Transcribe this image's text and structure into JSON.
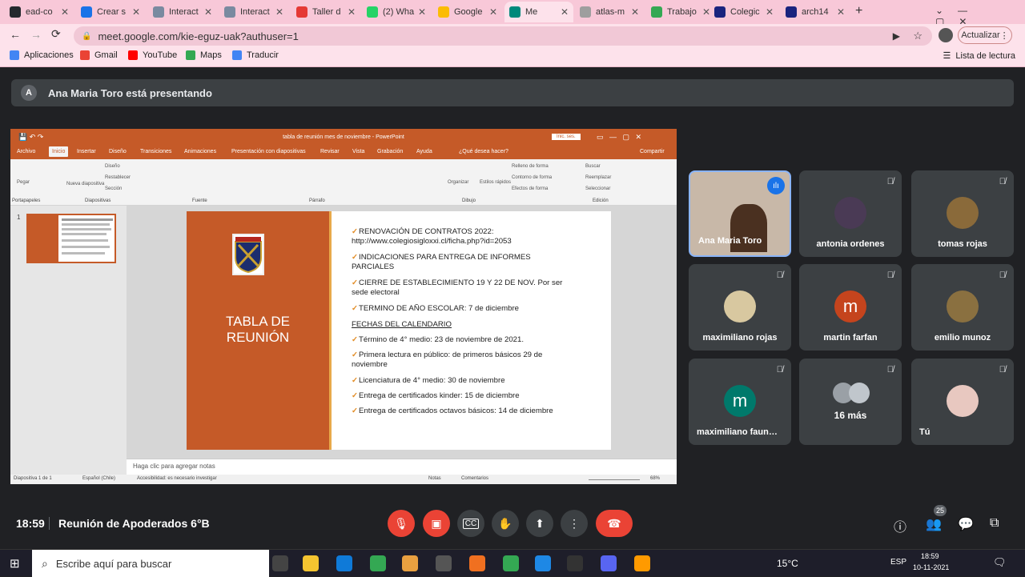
{
  "browser": {
    "tabs": [
      {
        "label": "ead-co",
        "color": "#24292e"
      },
      {
        "label": "Crear s",
        "color": "#1a73e8"
      },
      {
        "label": "Interact",
        "color": "#7a8aa0"
      },
      {
        "label": "Interact",
        "color": "#7a8aa0"
      },
      {
        "label": "Taller d",
        "color": "#e53935"
      },
      {
        "label": "(2) Wha",
        "color": "#25d366"
      },
      {
        "label": "Google",
        "color": "#fbbc04"
      },
      {
        "label": "Me",
        "color": "#00897b",
        "active": true
      },
      {
        "label": "atlas-m",
        "color": "#9e9e9e"
      },
      {
        "label": "Trabajo",
        "color": "#34a853"
      },
      {
        "label": "Colegic",
        "color": "#1a237e"
      },
      {
        "label": "arch14",
        "color": "#1a237e"
      }
    ],
    "url": "meet.google.com/kie-eguz-uak?authuser=1",
    "update_label": "Actualizar",
    "bookmarks": [
      {
        "label": "Aplicaciones",
        "color": "#4285f4"
      },
      {
        "label": "Gmail",
        "color": "#ea4335"
      },
      {
        "label": "YouTube",
        "color": "#ff0000"
      },
      {
        "label": "Maps",
        "color": "#34a853"
      },
      {
        "label": "Traducir",
        "color": "#4285f4"
      }
    ],
    "reading_list": "Lista de lectura"
  },
  "meet": {
    "presenter_initial": "A",
    "presenter_text": "Ana Maria Toro está presentando",
    "time": "18:59",
    "meeting_title": "Reunión de Apoderados 6°B",
    "people_count": "25",
    "participants": [
      {
        "name": "Ana Maria Toro",
        "type": "video",
        "speaking": true
      },
      {
        "name": "antonia ordenes",
        "type": "photo",
        "color": "#4a3a55"
      },
      {
        "name": "tomas rojas",
        "type": "photo",
        "color": "#8a6a3a"
      },
      {
        "name": "maximiliano rojas",
        "type": "photo",
        "color": "#d8c8a0"
      },
      {
        "name": "martin farfan",
        "type": "letter",
        "letter": "m",
        "color": "#c5441d"
      },
      {
        "name": "emilio munoz",
        "type": "photo",
        "color": "#8a7040"
      },
      {
        "name": "maximiliano faun…",
        "type": "letter",
        "letter": "m",
        "color": "#00796b"
      },
      {
        "name": "",
        "type": "more",
        "more_label": "16 más",
        "color": "#9aa0a6"
      },
      {
        "name": "Tú",
        "type": "photo",
        "color": "#e8c8c0"
      }
    ]
  },
  "ppt": {
    "window_title": "tabla de reunión mes de noviembre - PowerPoint",
    "signin": "Inic. ses.",
    "menu": [
      "Archivo",
      "Inicio",
      "Insertar",
      "Diseño",
      "Transiciones",
      "Animaciones",
      "Presentación con diapositivas",
      "Revisar",
      "Vista",
      "Grabación",
      "Ayuda",
      "¿Qué desea hacer?"
    ],
    "share": "Compartir",
    "ribbon_groups": [
      "Portapapeles",
      "Diapositivas",
      "Fuente",
      "Párrafo",
      "Dibujo",
      "Edición"
    ],
    "ribbon_items": {
      "paste": "Pegar",
      "new_slide": "Nueva diapositiva",
      "layout": "Diseño",
      "reset": "Restablecer",
      "section": "Sección",
      "arrange": "Organizar",
      "quick_styles": "Estilos rápidos",
      "fill": "Relleno de forma",
      "outline": "Contorno de forma",
      "effects": "Efectos de forma",
      "find": "Buscar",
      "replace": "Reemplazar",
      "select": "Seleccionar"
    },
    "slide_number": "1",
    "slide_title": "TABLA DE REUNIÓN",
    "slide_lines": [
      {
        "check": true,
        "text": "RENOVACIÓN DE CONTRATOS  2022:\nhttp://www.colegiosigloxxi.cl/ficha.php?id=2053"
      },
      {
        "check": true,
        "text": "INDICACIONES PARA ENTREGA DE INFORMES\nPARCIALES"
      },
      {
        "check": true,
        "text": "CIERRE DE ESTABLECIMIENTO 19 Y 22 DE NOV. Por ser\nsede electoral"
      },
      {
        "check": true,
        "text": "TERMINO DE AÑO ESCOLAR: 7 de diciembre"
      },
      {
        "check": false,
        "text": "FECHAS DEL CALENDARIO"
      },
      {
        "check": true,
        "text": "Término  de 4° medio: 23 de noviembre de 2021."
      },
      {
        "check": true,
        "text": "Primera lectura en público: de primeros básicos 29 de\nnoviembre"
      },
      {
        "check": true,
        "text": "Licenciatura de 4° medio: 30 de noviembre"
      },
      {
        "check": true,
        "text": "Entrega de certificados kinder: 15 de diciembre"
      },
      {
        "check": true,
        "text": "Entrega de certificados octavos básicos: 14 de diciembre"
      }
    ],
    "notes_placeholder": "Haga clic para agregar notas",
    "status": {
      "slide": "Diapositiva 1 de 1",
      "lang": "Español (Chile)",
      "accessibility": "Accesibilidad: es necesario investigar",
      "notes": "Notas",
      "comments": "Comentarios",
      "zoom": "68%"
    }
  },
  "taskbar": {
    "search_placeholder": "Escribe aquí para buscar",
    "temp": "15°C",
    "lang": "ESP",
    "time": "18:59",
    "date": "10-11-2021"
  }
}
